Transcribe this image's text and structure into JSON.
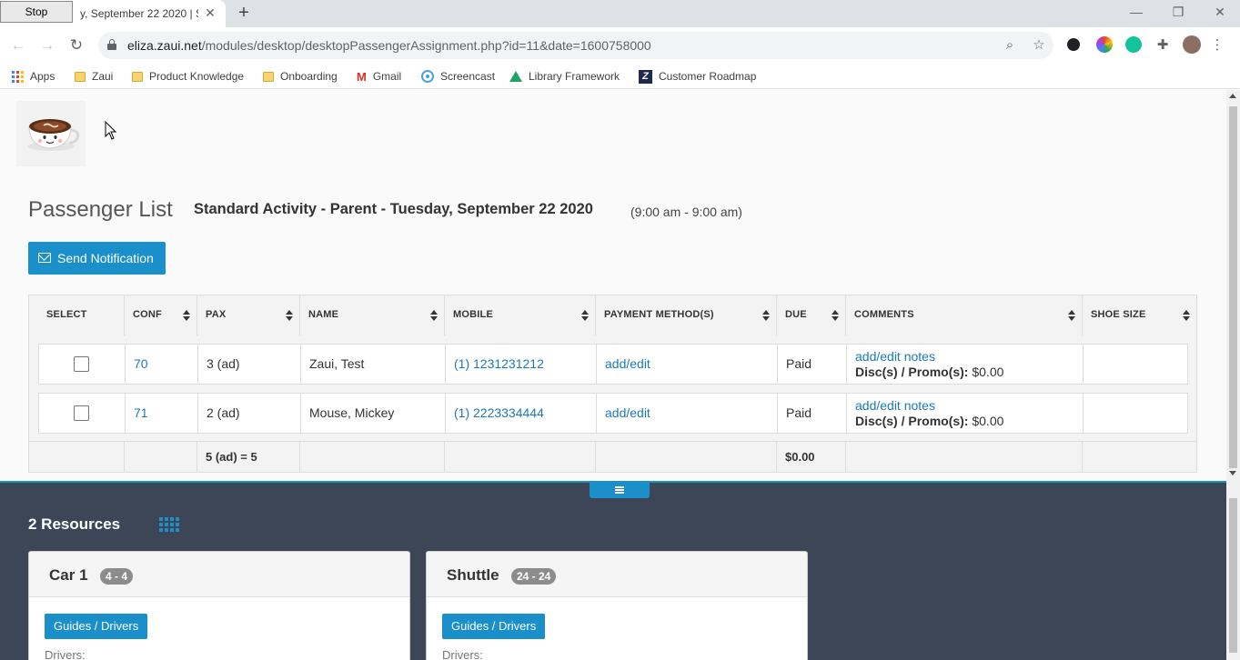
{
  "browser": {
    "tab_title": "y, September 22 2020 | St",
    "stop_label": "Stop",
    "url_host": "eliza.zaui.net",
    "url_path": "/modules/desktop/desktopPassengerAssignment.php?id=11&date=1600758000",
    "bookmarks": [
      {
        "label": "Apps",
        "icon": "apps-grid-icon"
      },
      {
        "label": "Zaui",
        "icon": "folder-icon"
      },
      {
        "label": "Product Knowledge",
        "icon": "folder-icon"
      },
      {
        "label": "Onboarding",
        "icon": "folder-icon"
      },
      {
        "label": "Gmail",
        "icon": "gmail-icon"
      },
      {
        "label": "Screencast",
        "icon": "screencast-icon"
      },
      {
        "label": "Library Framework",
        "icon": "drive-icon"
      },
      {
        "label": "Customer Roadmap",
        "icon": "roadmap-icon"
      }
    ]
  },
  "header": {
    "title": "Passenger List",
    "subtitle": "Standard Activity - Parent - Tuesday, September 22 2020",
    "time_range": "(9:00 am - 9:00 am)"
  },
  "actions": {
    "send_notification": "Send Notification"
  },
  "table": {
    "columns": [
      "SELECT",
      "CONF",
      "PAX",
      "NAME",
      "MOBILE",
      "PAYMENT METHOD(S)",
      "DUE",
      "COMMENTS",
      "SHOE SIZE"
    ],
    "rows": [
      {
        "conf": "70",
        "pax": "3 (ad)",
        "name": "Zaui, Test",
        "mobile": "(1) 1231231212",
        "payment": "add/edit",
        "due": "Paid",
        "notes": "add/edit notes",
        "disc_label": "Disc(s) / Promo(s):",
        "disc_value": "$0.00",
        "shoe": ""
      },
      {
        "conf": "71",
        "pax": "2 (ad)",
        "name": "Mouse, Mickey",
        "mobile": "(1) 2223334444",
        "payment": "add/edit",
        "due": "Paid",
        "notes": "add/edit notes",
        "disc_label": "Disc(s) / Promo(s):",
        "disc_value": "$0.00",
        "shoe": ""
      }
    ],
    "totals": {
      "pax": "5 (ad) = 5",
      "due": "$0.00"
    }
  },
  "resources": {
    "title": "2 Resources",
    "cards": [
      {
        "name": "Car 1",
        "capacity": "4 - 4",
        "button": "Guides / Drivers",
        "drivers_label": "Drivers:"
      },
      {
        "name": "Shuttle",
        "capacity": "24 - 24",
        "button": "Guides / Drivers",
        "drivers_label": "Drivers:"
      }
    ]
  },
  "colors": {
    "accent": "#1a8fc9",
    "link": "#1a7ab8",
    "panel": "#3c4657"
  }
}
